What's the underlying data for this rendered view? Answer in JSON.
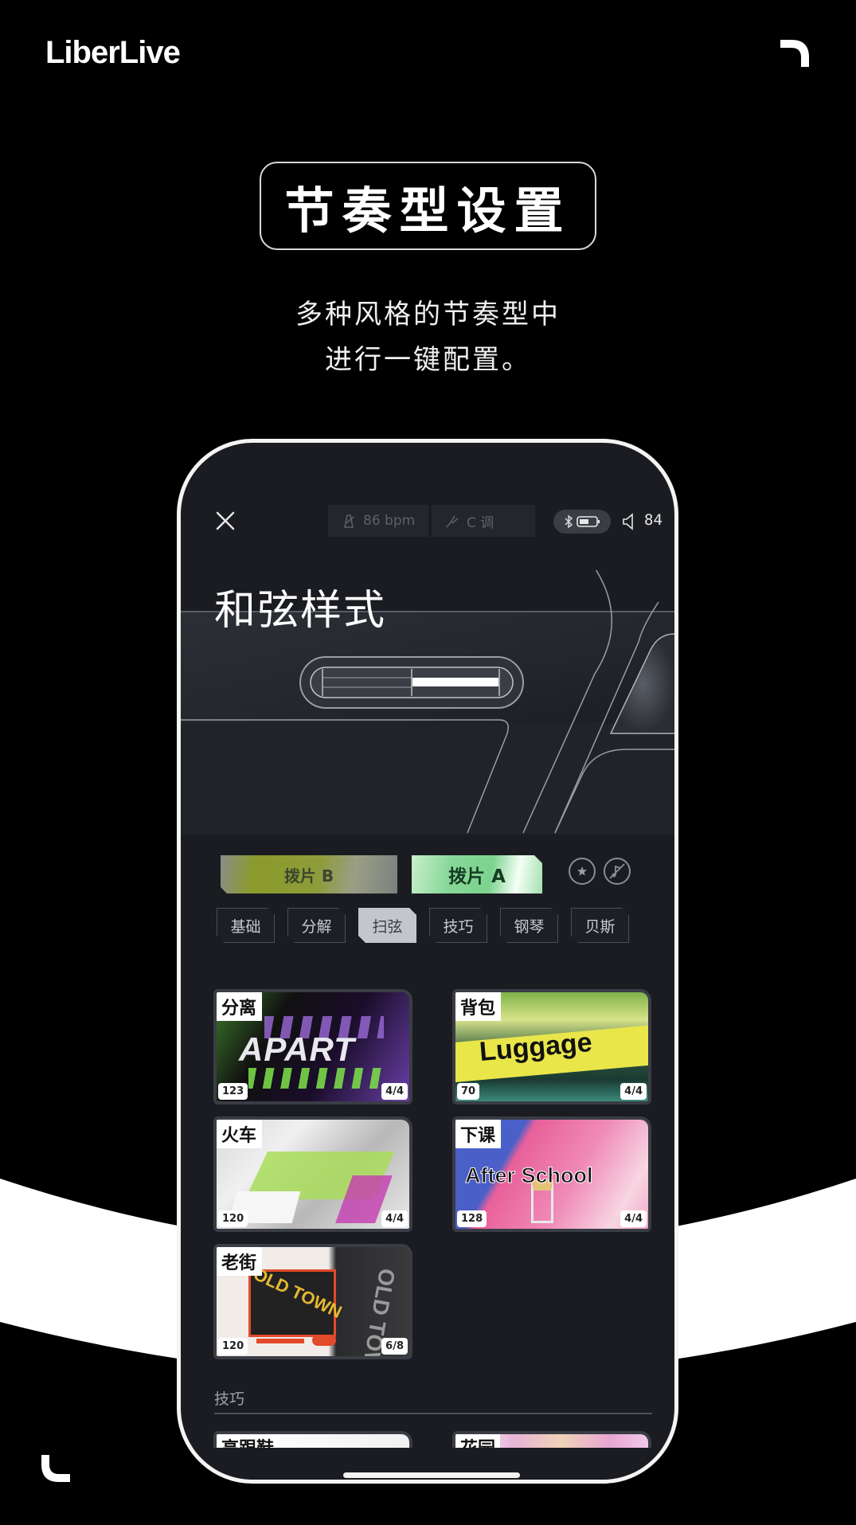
{
  "brand": {
    "logo_text": "LiberLive",
    "corner_top_right_icon": "corner-bracket-icon",
    "corner_bottom_left_icon": "corner-bracket-icon"
  },
  "hero": {
    "headline": "节奏型设置",
    "subtitle_line1": "多种风格的节奏型中",
    "subtitle_line2": "进行一键配置。"
  },
  "app": {
    "status_bar": {
      "close_icon": "close-icon",
      "tempo": {
        "icon": "metronome-icon",
        "label": "86 bpm"
      },
      "key": {
        "icon": "tuning-fork-icon",
        "label": "C 调"
      },
      "bluetooth_icon": "bluetooth-icon",
      "battery_icon": "battery-icon",
      "battery_level": 0.5,
      "volume_icon": "speaker-icon",
      "volume_value": "84"
    },
    "page_title": "和弦样式",
    "pick_buttons": [
      {
        "label": "拨片 B",
        "active": false
      },
      {
        "label": "拨片 A",
        "active": true
      }
    ],
    "action_icons": [
      "star-circle-icon",
      "music-off-icon"
    ],
    "tabs": [
      {
        "label": "基础",
        "active": false
      },
      {
        "label": "分解",
        "active": false
      },
      {
        "label": "扫弦",
        "active": true
      },
      {
        "label": "技巧",
        "active": false
      },
      {
        "label": "钢琴",
        "active": false
      },
      {
        "label": "贝斯",
        "active": false
      }
    ],
    "rhythm_cards": [
      {
        "label": "分离",
        "art_text": "APART",
        "bpm": "123",
        "beat": "4/4"
      },
      {
        "label": "背包",
        "art_text": "Luggage",
        "bpm": "70",
        "beat": "4/4"
      },
      {
        "label": "火车",
        "art_text": "",
        "bpm": "120",
        "beat": "4/4"
      },
      {
        "label": "下课",
        "art_text": "After School",
        "bpm": "128",
        "beat": "4/4"
      },
      {
        "label": "老街",
        "art_text": "OLD TOWN",
        "bpm": "120",
        "beat": "6/8"
      }
    ],
    "section_title": "技巧",
    "peek_cards": [
      {
        "label": "高跟鞋"
      },
      {
        "label": "花园"
      }
    ]
  }
}
